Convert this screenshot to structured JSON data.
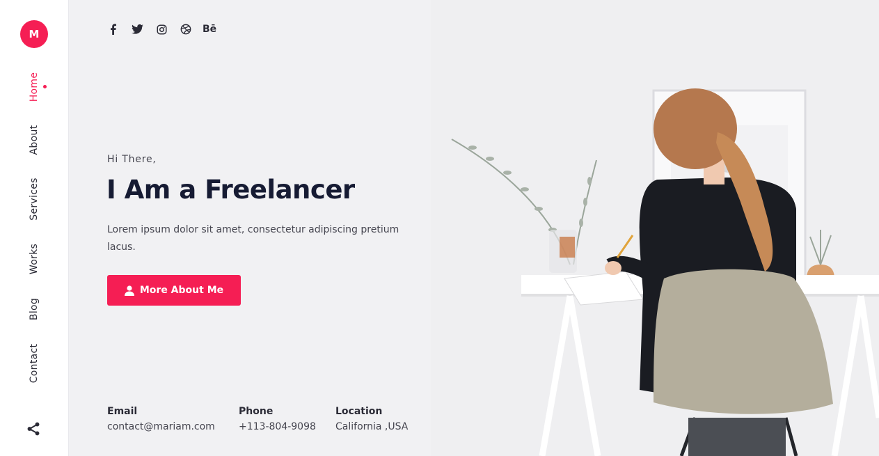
{
  "sidebar": {
    "logo_letter": "M",
    "nav": [
      {
        "label": "Home"
      },
      {
        "label": "About"
      },
      {
        "label": "Services"
      },
      {
        "label": "Works"
      },
      {
        "label": "Blog"
      },
      {
        "label": "Contact"
      }
    ],
    "share_icon": "share-icon"
  },
  "social": {
    "icons": [
      "facebook-icon",
      "twitter-icon",
      "instagram-icon",
      "dribbble-icon",
      "behance-icon"
    ],
    "behance_label": "Bē"
  },
  "hero": {
    "greeting": "Hi There,",
    "headline": "I Am a Freelancer",
    "description": "Lorem ipsum dolor sit amet, consectetur adipiscing pretium lacus.",
    "cta_label": "More About Me",
    "cta_icon": "user-icon"
  },
  "contact": {
    "email": {
      "label": "Email",
      "value": "contact@mariam.com"
    },
    "phone": {
      "label": "Phone",
      "value": "+113-804-9098"
    },
    "location": {
      "label": "Location",
      "value": "California ,USA"
    }
  },
  "colors": {
    "accent": "#f51e54",
    "heading": "#161b33",
    "text": "#45454f"
  }
}
